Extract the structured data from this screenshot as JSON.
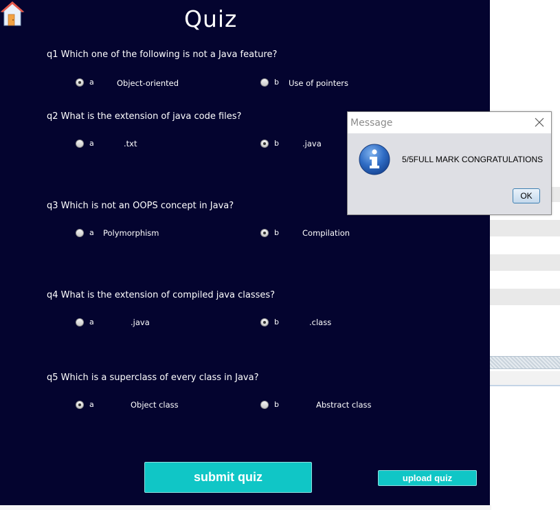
{
  "window": {
    "title": "Quiz"
  },
  "questions": [
    {
      "text": "q1 Which one of the following is not a Java feature?",
      "options": [
        {
          "letter": "a",
          "text": "Object-oriented",
          "selected": true
        },
        {
          "letter": "b",
          "text": "Use of pointers",
          "selected": false
        }
      ]
    },
    {
      "text": "q2 What is the extension of java code files?",
      "options": [
        {
          "letter": "a",
          "text": ".txt",
          "selected": false
        },
        {
          "letter": "b",
          "text": ".java",
          "selected": true
        }
      ]
    },
    {
      "text": "q3 Which is not an OOPS concept in Java?",
      "options": [
        {
          "letter": "a",
          "text": "Polymorphism",
          "selected": false
        },
        {
          "letter": "b",
          "text": "Compilation",
          "selected": true
        }
      ]
    },
    {
      "text": "q4 What is the extension of compiled java classes?",
      "options": [
        {
          "letter": "a",
          "text": ".java",
          "selected": false
        },
        {
          "letter": "b",
          "text": ".class",
          "selected": true
        }
      ]
    },
    {
      "text": "q5 Which is a superclass of every class in Java?",
      "options": [
        {
          "letter": "a",
          "text": "Object class",
          "selected": true
        },
        {
          "letter": "b",
          "text": "Abstract class",
          "selected": false
        }
      ]
    }
  ],
  "buttons": {
    "submit": "submit quiz",
    "upload": "upload quiz"
  },
  "dialog": {
    "title": "Message",
    "message": "5/5FULL MARK CONGRATULATIONS",
    "ok": "OK"
  },
  "colors": {
    "panel_bg": "#04042f",
    "accent": "#10c6c6"
  },
  "icons": {
    "home": "home-icon",
    "info": "info-icon",
    "close": "close-icon"
  }
}
